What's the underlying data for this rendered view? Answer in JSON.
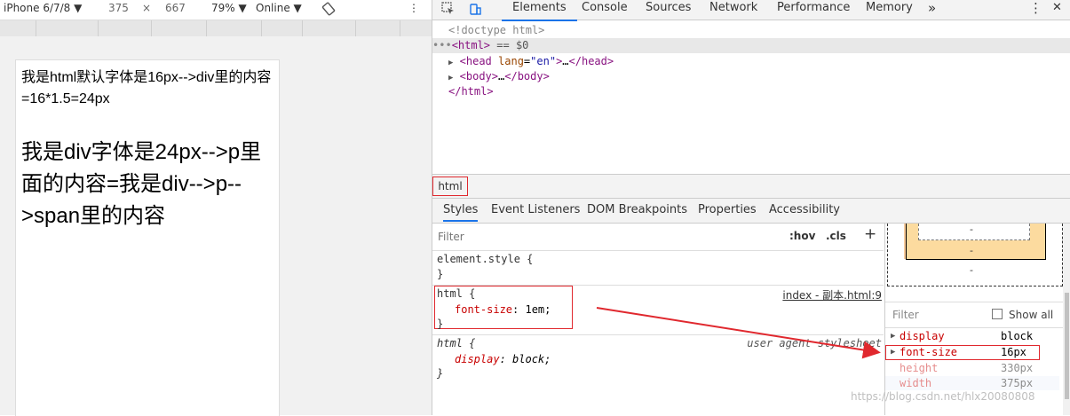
{
  "device": {
    "name": "iPhone 6/7/8 ▼",
    "width": "375",
    "times": "×",
    "height": "667",
    "zoom": "79% ▼",
    "network": "Online ▼"
  },
  "page": {
    "p1": "我是html默认字体是16px-->div里的内容=16*1.5=24px",
    "p2": "我是div字体是24px-->p里面的内容=我是div-->p-->span里的内容"
  },
  "devtools": {
    "tabs": [
      "Elements",
      "Console",
      "Sources",
      "Network",
      "Performance",
      "Memory"
    ],
    "more": "»",
    "menu": "⋮",
    "close": "✕",
    "dom": {
      "doctype": "<!doctype html>",
      "html_sel": "== $0",
      "head": "…",
      "body": "…"
    },
    "breadcrumb": "html",
    "subtabs": [
      "Styles",
      "Event Listeners",
      "DOM Breakpoints",
      "Properties",
      "Accessibility"
    ],
    "filter_placeholder": "Filter",
    "hov": ":hov",
    "cls": ".cls",
    "plus": "+",
    "rules": {
      "element_style": "element.style {",
      "close": "}",
      "html_sel": "html {",
      "html_prop": "font-size",
      "html_val": "1em;",
      "html_src": "index - 副本.html:9",
      "ua_sel": "html {",
      "ua_prop": "display",
      "ua_val": "block;",
      "ua_src": "user agent stylesheet"
    },
    "boxmodel": {
      "dash": "-"
    },
    "computed": {
      "filter": "Filter",
      "show_all": "Show all",
      "rows": [
        {
          "name": "display",
          "value": "block"
        },
        {
          "name": "font-size",
          "value": "16px"
        },
        {
          "name": "height",
          "value": "330px"
        },
        {
          "name": "width",
          "value": "375px"
        }
      ]
    }
  },
  "watermark": "https://blog.csdn.net/hlx20080808",
  "colors": {
    "accent": "#1a73e8",
    "highlight": "#e0282e"
  }
}
